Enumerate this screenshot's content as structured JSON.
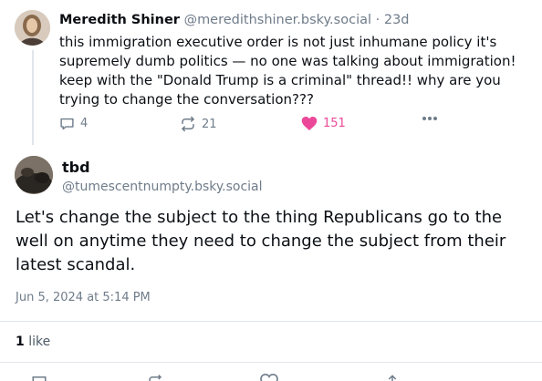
{
  "parent_post": {
    "author_name": "Meredith Shiner",
    "author_handle": "@meredithshiner.bsky.social",
    "separator": "·",
    "time_ago": "23d",
    "text": "this immigration executive order is not just inhumane policy it's supremely dumb politics — no one was talking about immigration! keep with the \"Donald Trump is a criminal\" thread!! why are you trying to change the conversation???",
    "reply_count": "4",
    "repost_count": "21",
    "like_count": "151",
    "like_color": "#ec4899"
  },
  "main_post": {
    "author_name": "tbd",
    "author_handle": "@tumescentnumpty.bsky.social",
    "text": "Let's change the subject to the thing Republicans go to the well on anytime they need to change the subject from their latest scandal.",
    "timestamp": "Jun 5, 2024 at 5:14 PM",
    "like_count": "1",
    "like_label": "like"
  },
  "icons": {
    "reply": "speech-bubble-icon",
    "repost": "repost-arrows-icon",
    "like": "heart-icon",
    "more": "ellipsis-icon"
  },
  "colors": {
    "muted_text": "#6f7c8a",
    "divider": "#e1e6eb"
  }
}
